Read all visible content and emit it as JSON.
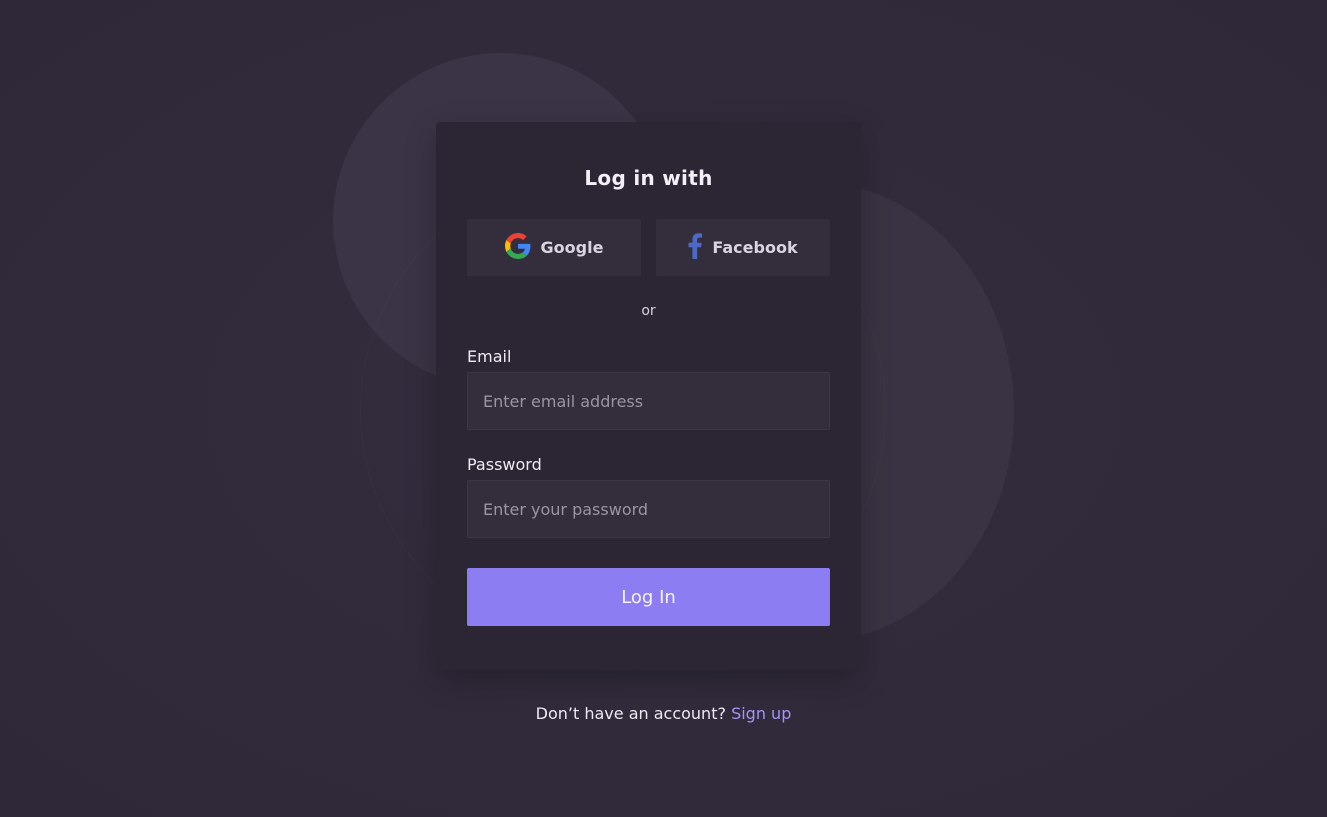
{
  "card": {
    "title": "Log in with",
    "social": {
      "google_label": "Google",
      "facebook_label": "Facebook"
    },
    "divider_text": "or",
    "email": {
      "label": "Email",
      "placeholder": "Enter email address",
      "value": ""
    },
    "password": {
      "label": "Password",
      "placeholder": "Enter your password",
      "value": ""
    },
    "submit_label": "Log In"
  },
  "footer": {
    "prompt": "Don’t have an account?",
    "signup_label": "Sign up"
  },
  "icons": {
    "google": "google-icon",
    "facebook": "facebook-icon"
  },
  "colors": {
    "accent": "#8c7ef2",
    "link": "#a394f5",
    "background": "#312b3b",
    "card": "#2c2634",
    "facebook_blue": "#4c6ac4"
  }
}
